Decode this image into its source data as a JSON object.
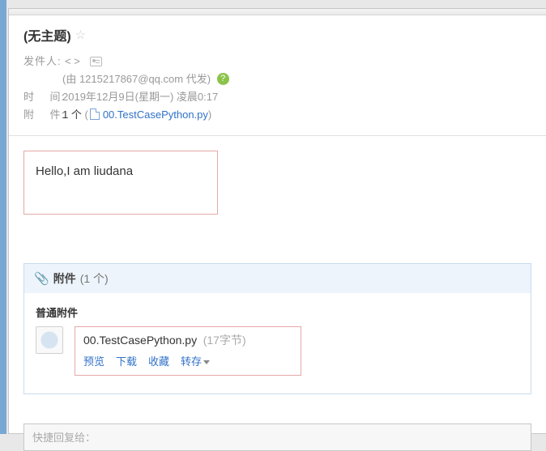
{
  "subject": "(无主题)",
  "labels": {
    "sender": "发件人:",
    "time": "时    间:",
    "attach": "附    件:"
  },
  "sender_angles": "< >",
  "sent_by_prefix": "(由 ",
  "sent_by_email": "1215217867@qq.com",
  "sent_by_suffix": " 代发)",
  "help_badge": "?",
  "time_value": "2019年12月9日(星期一) 凌晨0:17",
  "attach_summary": {
    "count_text": "1 个",
    "open_paren": "(",
    "filename": "00.TestCasePython.py",
    "close_paren": ")"
  },
  "body_text": "Hello,I am liudana",
  "attachments": {
    "section_title": "附件",
    "section_count": "(1 个)",
    "normal_label": "普通附件",
    "item": {
      "filename": "00.TestCasePython.py",
      "size": "(17字节)",
      "actions": {
        "preview": "预览",
        "download": "下载",
        "favorite": "收藏",
        "forward": "转存"
      }
    }
  },
  "reply_placeholder": "快捷回复给："
}
